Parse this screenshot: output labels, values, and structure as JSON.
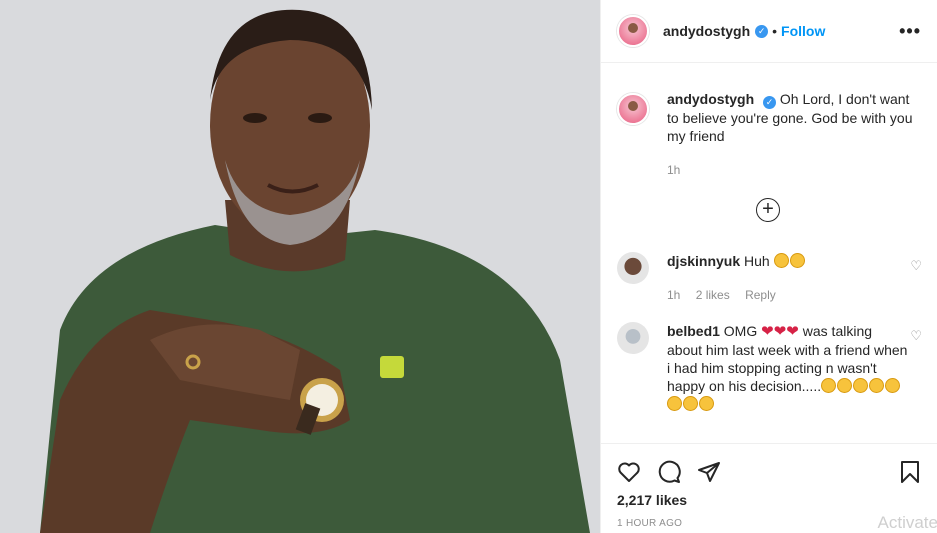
{
  "header": {
    "username": "andydostygh",
    "separator": "•",
    "follow_label": "Follow",
    "more_label": "•••"
  },
  "caption": {
    "username": "andydostygh",
    "text": "Oh Lord, I don't want to believe you're gone. God be with you my friend",
    "time": "1h"
  },
  "load_more_label": "+",
  "comments": [
    {
      "username": "djskinnyuk",
      "text": "Huh",
      "emojis": [
        "flushed-face",
        "flushed-face"
      ],
      "time": "1h",
      "likes": "2 likes",
      "reply_label": "Reply"
    },
    {
      "username": "belbed1",
      "text_before": "OMG",
      "hearts": [
        "❤",
        "❤",
        "❤"
      ],
      "text_after": "was talking about him last week with a friend when i had him stopping acting n wasn't happy on his decision.....",
      "emojis_trailing": [
        "thinking-face",
        "thinking-face",
        "thinking-face",
        "confused-face",
        "confused-face",
        "confused-face",
        "confused-face",
        "confused-face"
      ]
    }
  ],
  "actions": {
    "likes": "2,217 likes",
    "time_ago": "1 HOUR AGO"
  },
  "watermark": "Activate",
  "colors": {
    "accent": "#0095f6",
    "verified": "#3897f0",
    "muted": "#8e8e8e",
    "heart": "#d62246"
  }
}
